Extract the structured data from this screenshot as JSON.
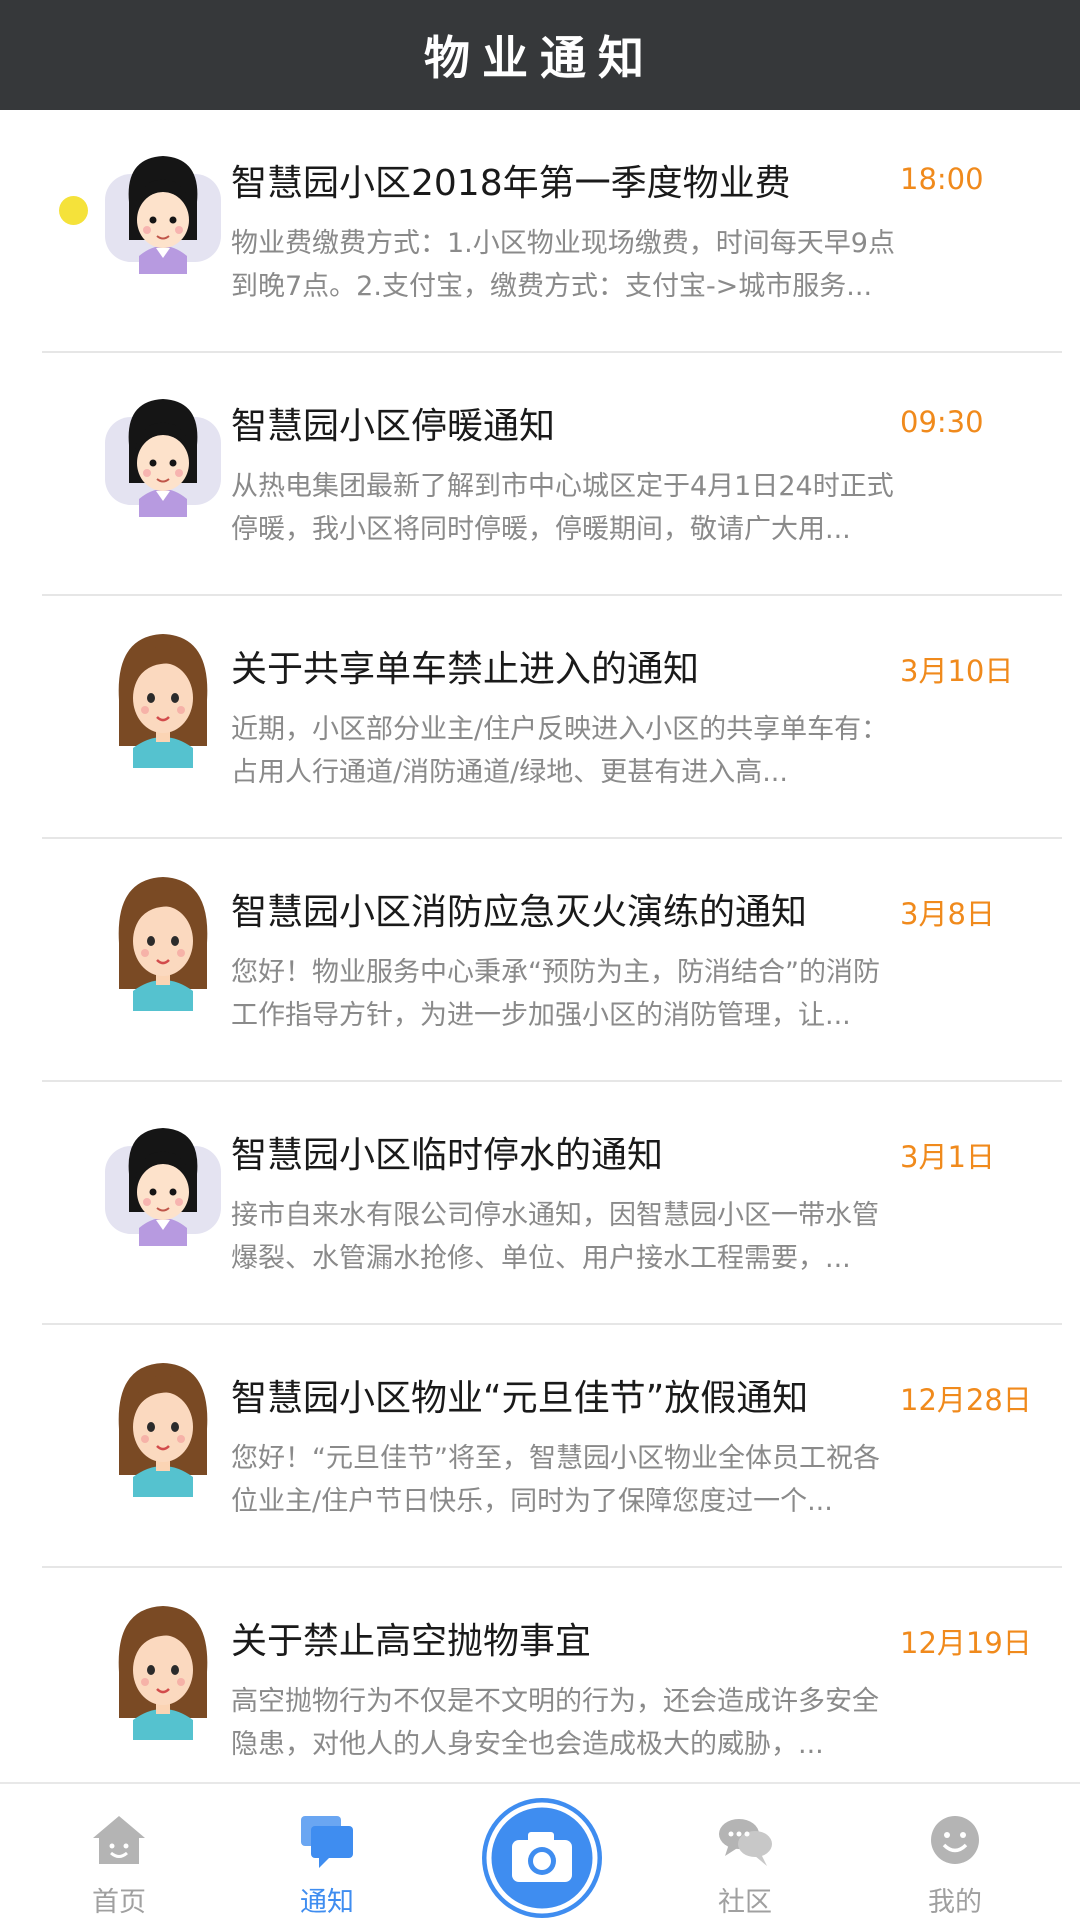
{
  "header": {
    "title": "物业通知"
  },
  "notices": [
    {
      "title": "智慧园小区2018年第一季度物业费",
      "time": "18:00",
      "summary": "物业费缴费方式：1.小区物业现场缴费，时间每天早9点到晚7点。2.支付宝，缴费方式：支付宝->城市服务...",
      "avatar": "short-hair-girl-avatar",
      "unread": true
    },
    {
      "title": "智慧园小区停暖通知",
      "time": "09:30",
      "summary": "从热电集团最新了解到市中心城区定于4月1日24时正式停暖，我小区将同时停暖，停暖期间，敬请广大用...",
      "avatar": "short-hair-girl-avatar",
      "unread": false
    },
    {
      "title": "关于共享单车禁止进入的通知",
      "time": "3月10日",
      "summary": "近期，小区部分业主/住户反映进入小区的共享单车有：占用人行通道/消防通道/绿地、更甚有进入高...",
      "avatar": "long-hair-girl-avatar",
      "unread": false
    },
    {
      "title": "智慧园小区消防应急灭火演练的通知",
      "time": "3月8日",
      "summary": "您好！物业服务中心秉承“预防为主，防消结合”的消防工作指导方针，为进一步加强小区的消防管理，让...",
      "avatar": "long-hair-girl-avatar",
      "unread": false
    },
    {
      "title": "智慧园小区临时停水的通知",
      "time": "3月1日",
      "summary": "接市自来水有限公司停水通知，因智慧园小区一带水管爆裂、水管漏水抢修、单位、用户接水工程需要，...",
      "avatar": "short-hair-girl-avatar",
      "unread": false
    },
    {
      "title": "智慧园小区物业“元旦佳节”放假通知",
      "time": "12月28日",
      "summary": "您好！“元旦佳节”将至，智慧园小区物业全体员工祝各位业主/住户节日快乐，同时为了保障您度过一个...",
      "avatar": "long-hair-girl-avatar",
      "unread": false
    },
    {
      "title": "关于禁止高空抛物事宜",
      "time": "12月19日",
      "summary": "高空抛物行为不仅是不文明的行为，还会造成许多安全隐患，对他人的人身安全也会造成极大的威胁，...",
      "avatar": "long-hair-girl-avatar",
      "unread": false
    }
  ],
  "tabbar": {
    "home_label": "首页",
    "notice_label": "通知",
    "community_label": "社区",
    "mine_label": "我的",
    "active": "通知",
    "camera_icon": "camera-icon"
  },
  "colors": {
    "header_bg": "#36383a",
    "time": "#f08a1c",
    "active_tab": "#3f8df0",
    "unread_dot": "#f5e23a"
  }
}
